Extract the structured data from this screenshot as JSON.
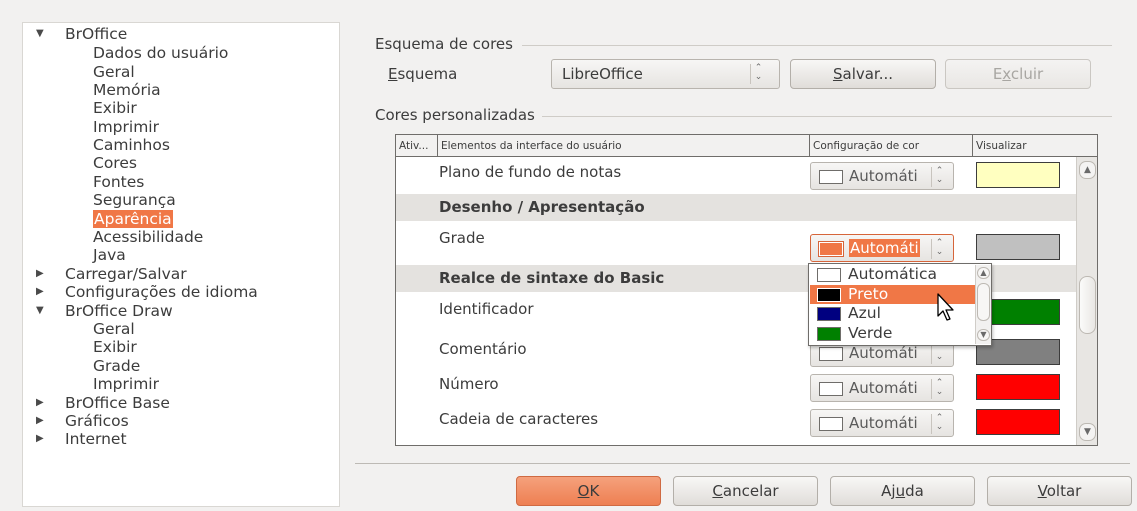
{
  "tree": {
    "items": [
      {
        "label": "BrOffice",
        "arrow": "▼",
        "level": 0
      },
      {
        "label": "Dados do usuário",
        "level": 1
      },
      {
        "label": "Geral",
        "level": 1
      },
      {
        "label": "Memória",
        "level": 1
      },
      {
        "label": "Exibir",
        "level": 1
      },
      {
        "label": "Imprimir",
        "level": 1
      },
      {
        "label": "Caminhos",
        "level": 1
      },
      {
        "label": "Cores",
        "level": 1
      },
      {
        "label": "Fontes",
        "level": 1
      },
      {
        "label": "Segurança",
        "level": 1
      },
      {
        "label": "Aparência",
        "level": 1,
        "selected": true
      },
      {
        "label": "Acessibilidade",
        "level": 1
      },
      {
        "label": "Java",
        "level": 1
      },
      {
        "label": "Carregar/Salvar",
        "arrow": "▶",
        "level": 0
      },
      {
        "label": "Configurações de idioma",
        "arrow": "▶",
        "level": 0
      },
      {
        "label": "BrOffice Draw",
        "arrow": "▼",
        "level": 0
      },
      {
        "label": "Geral",
        "level": 1
      },
      {
        "label": "Exibir",
        "level": 1
      },
      {
        "label": "Grade",
        "level": 1
      },
      {
        "label": "Imprimir",
        "level": 1
      },
      {
        "label": "BrOffice Base",
        "arrow": "▶",
        "level": 0
      },
      {
        "label": "Gráficos",
        "arrow": "▶",
        "level": 0
      },
      {
        "label": "Internet",
        "arrow": "▶",
        "level": 0
      }
    ]
  },
  "scheme": {
    "section_title": "Esquema de cores",
    "label_first": "E",
    "label_rest": "squema",
    "value": "LibreOffice",
    "save_first": "S",
    "save_rest": "alvar...",
    "delete_pre": "E",
    "delete_u": "x",
    "delete_post": "cluir"
  },
  "custom": {
    "section_title": "Cores personalizadas",
    "columns": [
      "Ativ...",
      "Elementos da interface do usuário",
      "Configuração de cor",
      "Visualizar"
    ],
    "rows": [
      {
        "name": "Plano de fundo de notas",
        "color_value": "Automáti",
        "preview": "#ffffc0"
      },
      {
        "name": "Desenho / Apresentação",
        "group": true
      },
      {
        "name": "Grade",
        "color_value": "Automáti",
        "preview": "#c0c0c0",
        "active": true
      },
      {
        "name": "Realce de sintaxe do Basic",
        "group": true
      },
      {
        "name": "Identificador",
        "color_value": "Automáti",
        "preview": "#008000"
      },
      {
        "name": "Comentário",
        "color_value": "Automáti",
        "preview": "#808080"
      },
      {
        "name": "Número",
        "color_value": "Automáti",
        "preview": "#ff0000"
      },
      {
        "name": "Cadeia de caracteres",
        "color_value": "Automáti",
        "preview": "#ff0000"
      }
    ]
  },
  "dropdown": {
    "options": [
      {
        "label": "Automática",
        "swatch": "#ffffff"
      },
      {
        "label": "Preto",
        "swatch": "#000000",
        "highlighted": true
      },
      {
        "label": "Azul",
        "swatch": "#000080"
      },
      {
        "label": "Verde",
        "swatch": "#008000"
      }
    ]
  },
  "footer": {
    "ok_u": "O",
    "ok_rest": "K",
    "cancel_u": "C",
    "cancel_rest": "ancelar",
    "help_pre": "Aj",
    "help_u": "u",
    "help_post": "da",
    "back_u": "V",
    "back_rest": "oltar"
  },
  "colors": {
    "accent": "#f07746",
    "panel_bg": "#f2f1f0"
  }
}
